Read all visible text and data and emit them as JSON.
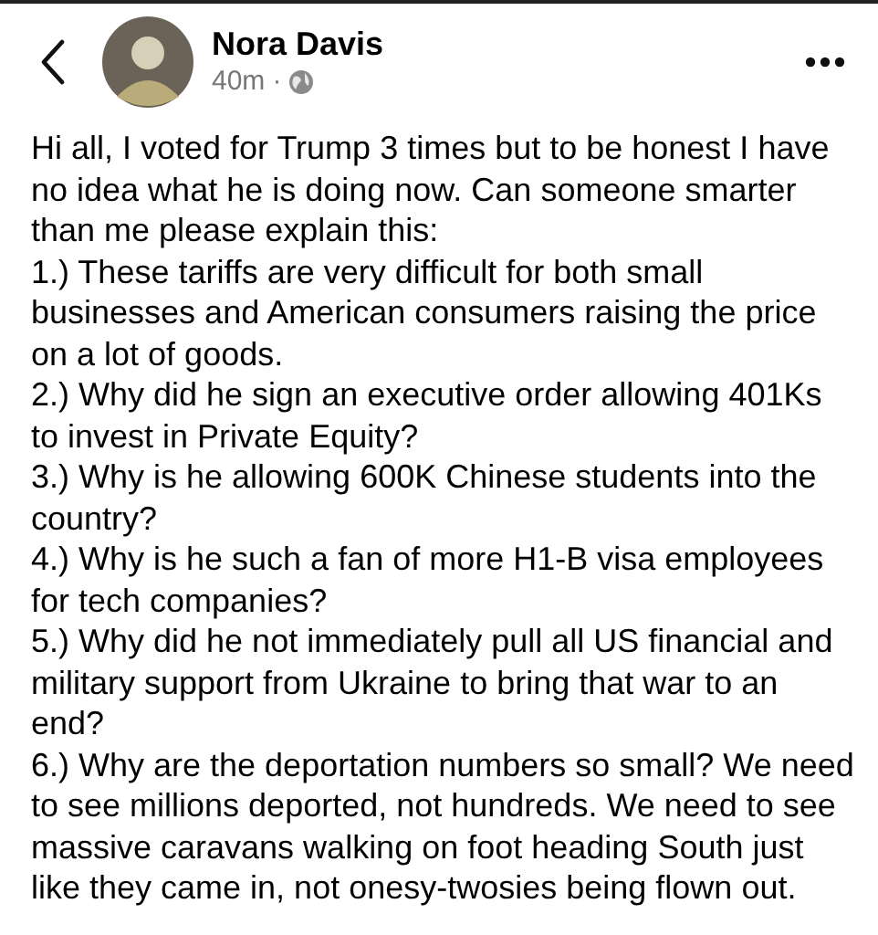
{
  "post": {
    "author": "Nora Davis",
    "time": "40m",
    "separator": "·",
    "paragraphs": [
      "Hi all, I voted for Trump 3 times but to be honest I have no idea what he is doing now. Can someone smarter than me please explain this:",
      "1.) These tariffs are very difficult for both small businesses and American consumers raising the price on a lot of goods.",
      "2.) Why did he sign an executive order allowing 401Ks to invest in Private Equity?",
      "3.) Why is he allowing 600K Chinese students into the country?",
      "4.) Why is he such a fan of more H1-B visa employees for tech companies?",
      "5.) Why did he not immediately pull all US financial and military support from Ukraine to bring that war to an end?",
      "6.) Why are the deportation numbers so small? We need to see millions deported, not hundreds. We need to see massive caravans walking on foot heading South just like they came in, not onesy-twosies being flown out."
    ]
  }
}
